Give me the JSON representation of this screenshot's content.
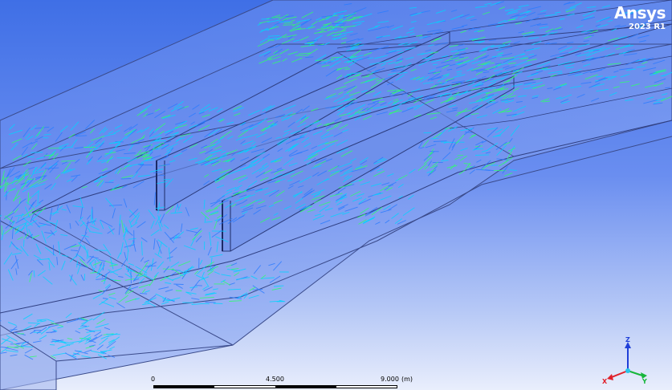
{
  "logo": {
    "brand": "Ansys",
    "version": "2023 R1"
  },
  "scale": {
    "min_label": "0",
    "mid_label": "4.500",
    "max_label": "9.000",
    "unit": "(m)"
  },
  "triad": {
    "x_label": "X",
    "y_label": "Y",
    "z_label": "Z"
  },
  "colors": {
    "background_top": "#3f6fe6",
    "background_bottom": "#e9eefc",
    "geometry_fill": "#7d9df0",
    "edge": "#3a4a8a",
    "vector_cyan": "#00d4ff",
    "vector_blue": "#2a7bff",
    "vector_green": "#2cff6a"
  }
}
